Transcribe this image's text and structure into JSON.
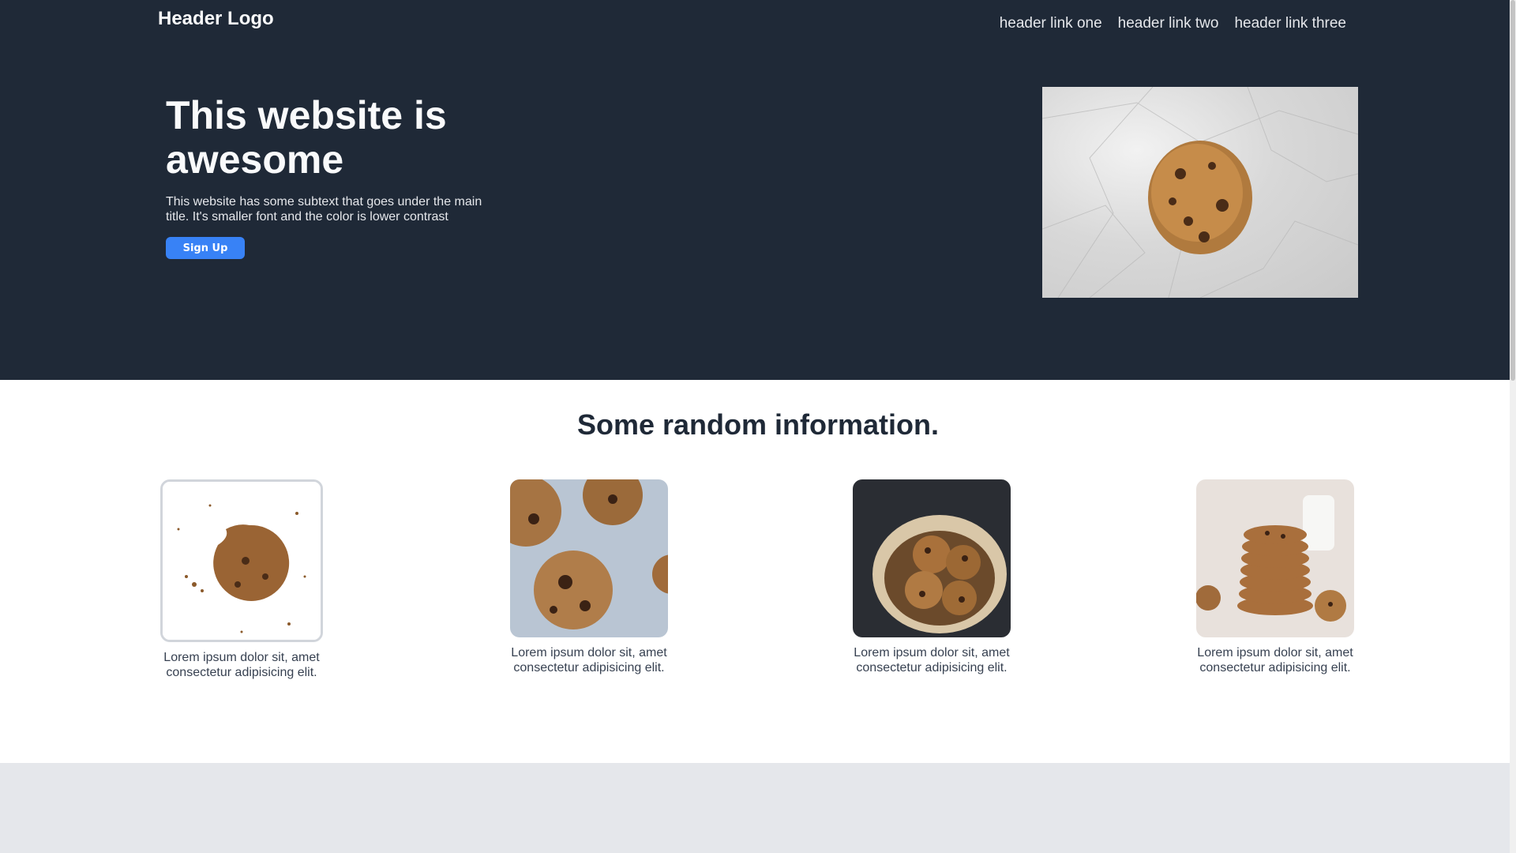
{
  "header": {
    "logo": "Header Logo",
    "links": [
      "header link one",
      "header link two",
      "header link three"
    ]
  },
  "hero": {
    "title": "This website is awesome",
    "subtext": "This website has some subtext that goes under the main title. It's smaller font and the color is lower contrast",
    "button_label": "Sign Up",
    "image": "cookie-on-crumpled-paper-photo"
  },
  "info": {
    "title": "Some random information.",
    "cards": [
      {
        "image": "bitten-cookie-with-crumbs-photo",
        "text": "Lorem ipsum dolor sit, amet consectetur adipisicing elit."
      },
      {
        "image": "broken-chocolate-chip-cookies-photo",
        "text": "Lorem ipsum dolor sit, amet consectetur adipisicing elit."
      },
      {
        "image": "cookies-in-basket-photo",
        "text": "Lorem ipsum dolor sit, amet consectetur adipisicing elit."
      },
      {
        "image": "stacked-cookies-with-milk-photo",
        "text": "Lorem ipsum dolor sit, amet consectetur adipisicing elit."
      }
    ]
  },
  "colors": {
    "hero_bg": "#1f2937",
    "button_bg": "#3882f6",
    "footer_bg": "#e5e7eb"
  }
}
